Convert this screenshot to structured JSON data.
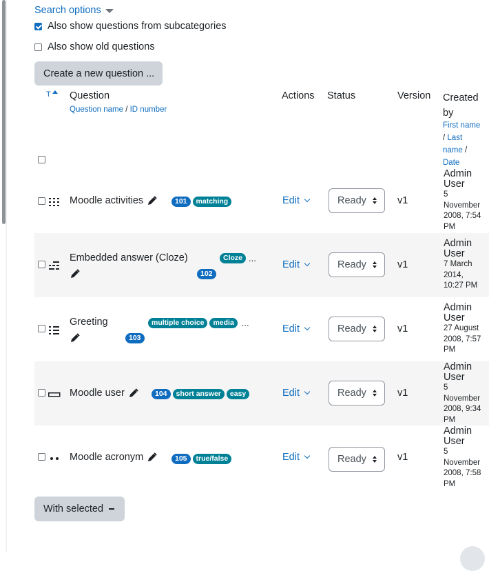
{
  "search_options": {
    "label": "Search options"
  },
  "options": {
    "subcategories": {
      "label": "Also show questions from subcategories",
      "checked": true
    },
    "old_questions": {
      "label": "Also show old questions",
      "checked": false
    }
  },
  "create_button": {
    "label": "Create a new question ..."
  },
  "table_header": {
    "sort_indicator": "T",
    "question": "Question",
    "question_name_link": "Question name",
    "separator": "/",
    "id_number_link": "ID number",
    "actions": "Actions",
    "status": "Status",
    "version": "Version",
    "created_by_line1": "Created",
    "created_by_line2": "by",
    "first_name_link": "First name",
    "last_name_link": "Last",
    "last_name_link2": "name",
    "date_link": "Date"
  },
  "rows": [
    {
      "name": "Moodle activities",
      "qtype_icon": "matching-icon",
      "id_badge": "101",
      "tags": [
        "matching"
      ],
      "more": "",
      "action": "Edit",
      "status": "Ready",
      "version": "v1",
      "creator_first": "Admin",
      "creator_last": "User",
      "date_lines": [
        "5",
        "November",
        "2008, 7:54",
        "PM"
      ]
    },
    {
      "name": "Embedded answer (Cloze)",
      "qtype_icon": "cloze-icon",
      "id_badge": "102",
      "tags": [
        "Cloze"
      ],
      "more": "...",
      "action": "Edit",
      "status": "Ready",
      "version": "v1",
      "creator_first": "Admin",
      "creator_last": "User",
      "date_lines": [
        "7 March",
        "2014,",
        "10:27 PM"
      ]
    },
    {
      "name": "Greeting",
      "qtype_icon": "multichoice-icon",
      "id_badge": "103",
      "tags": [
        "multiple choice",
        "media"
      ],
      "more": "...",
      "action": "Edit",
      "status": "Ready",
      "version": "v1",
      "creator_first": "Admin",
      "creator_last": "User",
      "date_lines": [
        "27 August",
        "2008, 7:57",
        "PM"
      ]
    },
    {
      "name": "Moodle user",
      "qtype_icon": "shortanswer-icon",
      "id_badge": "104",
      "tags": [
        "short answer",
        "easy"
      ],
      "more": "",
      "action": "Edit",
      "status": "Ready",
      "version": "v1",
      "creator_first": "Admin",
      "creator_last": "User",
      "date_lines": [
        "5",
        "November",
        "2008, 9:34",
        "PM"
      ]
    },
    {
      "name": "Moodle acronym",
      "qtype_icon": "truefalse-icon",
      "id_badge": "105",
      "tags": [
        "true/false"
      ],
      "more": "",
      "action": "Edit",
      "status": "Ready",
      "version": "v1",
      "creator_first": "Admin",
      "creator_last": "User",
      "date_lines": [
        "5",
        "November",
        "2008, 7:58",
        "PM"
      ]
    }
  ],
  "with_selected": {
    "label": "With selected"
  },
  "colors": {
    "link": "#0f6cbf",
    "badge_blue": "#0f6cbf",
    "badge_teal": "#008196",
    "button_grey": "#ced4da",
    "row_alt": "#f5f5f5"
  }
}
